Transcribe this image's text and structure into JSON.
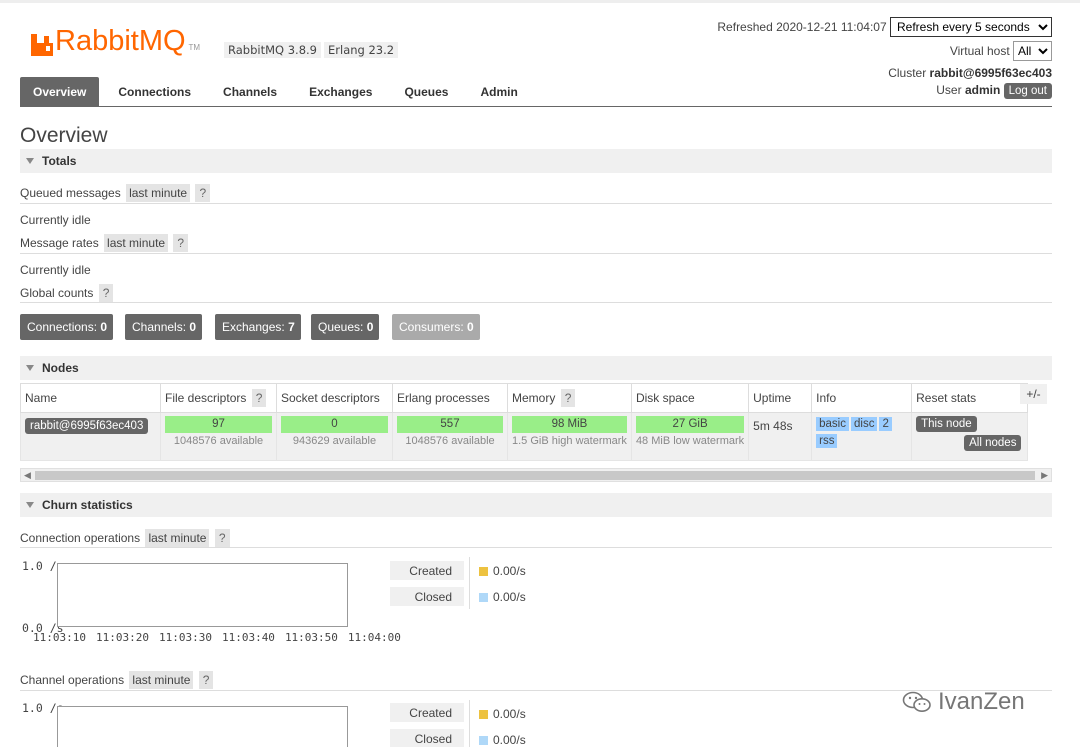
{
  "header": {
    "logo_text": "RabbitMQ",
    "logo_tm": "TM",
    "version_rabbit": "RabbitMQ 3.8.9",
    "version_erlang": "Erlang 23.2",
    "refreshed_label": "Refreshed",
    "refreshed_time": "2020-12-21 11:04:07",
    "refresh_option": "Refresh every 5 seconds",
    "vhost_label": "Virtual host",
    "vhost_value": "All",
    "cluster_label": "Cluster",
    "cluster_name": "rabbit@6995f63ec403",
    "user_label": "User",
    "user_name": "admin",
    "logout_label": "Log out"
  },
  "tabs": [
    {
      "label": "Overview",
      "active": true
    },
    {
      "label": "Connections",
      "active": false
    },
    {
      "label": "Channels",
      "active": false
    },
    {
      "label": "Exchanges",
      "active": false
    },
    {
      "label": "Queues",
      "active": false
    },
    {
      "label": "Admin",
      "active": false
    }
  ],
  "page_title": "Overview",
  "totals": {
    "section_title": "Totals",
    "queued_label": "Queued messages",
    "queued_range": "last minute",
    "help": "?",
    "queued_status": "Currently idle",
    "rates_label": "Message rates",
    "rates_range": "last minute",
    "rates_status": "Currently idle",
    "global_label": "Global counts"
  },
  "counts": [
    {
      "label": "Connections:",
      "value": "0"
    },
    {
      "label": "Channels:",
      "value": "0"
    },
    {
      "label": "Exchanges:",
      "value": "7"
    },
    {
      "label": "Queues:",
      "value": "0"
    },
    {
      "label": "Consumers:",
      "value": "0"
    }
  ],
  "nodes": {
    "section_title": "Nodes",
    "columns": [
      "Name",
      "File descriptors",
      "Socket descriptors",
      "Erlang processes",
      "Memory",
      "Disk space",
      "Uptime",
      "Info",
      "Reset stats"
    ],
    "plusminus": "+/-",
    "row": {
      "name": "rabbit@6995f63ec403",
      "fd_value": "97",
      "fd_sub": "1048576 available",
      "sock_value": "0",
      "sock_sub": "943629 available",
      "proc_value": "557",
      "proc_sub": "1048576 available",
      "mem_value": "98 MiB",
      "mem_sub": "1.5 GiB high watermark",
      "disk_value": "27 GiB",
      "disk_sub": "48 MiB low watermark",
      "uptime": "5m 48s",
      "info_tags": [
        "basic",
        "disc",
        "2",
        "rss"
      ],
      "reset_this": "This node",
      "reset_all": "All nodes"
    }
  },
  "churn": {
    "section_title": "Churn statistics",
    "conn_label": "Connection operations",
    "conn_range": "last minute",
    "chan_label": "Channel operations",
    "chan_range": "last minute",
    "y_top": "1.0 /s",
    "y_bottom": "0.0 /s",
    "x_ticks": [
      "11:03:10",
      "11:03:20",
      "11:03:30",
      "11:03:40",
      "11:03:50",
      "11:04:00"
    ],
    "created_label": "Created",
    "closed_label": "Closed",
    "created_value": "0.00/s",
    "closed_value": "0.00/s",
    "created_color": "#edc240",
    "closed_color": "#afd8f8"
  },
  "watermark": "IvanZen",
  "colors": {
    "accent": "#ff6600",
    "bar_green": "#99ee88",
    "info_blue": "#99ccff",
    "dark_button": "#666666"
  }
}
